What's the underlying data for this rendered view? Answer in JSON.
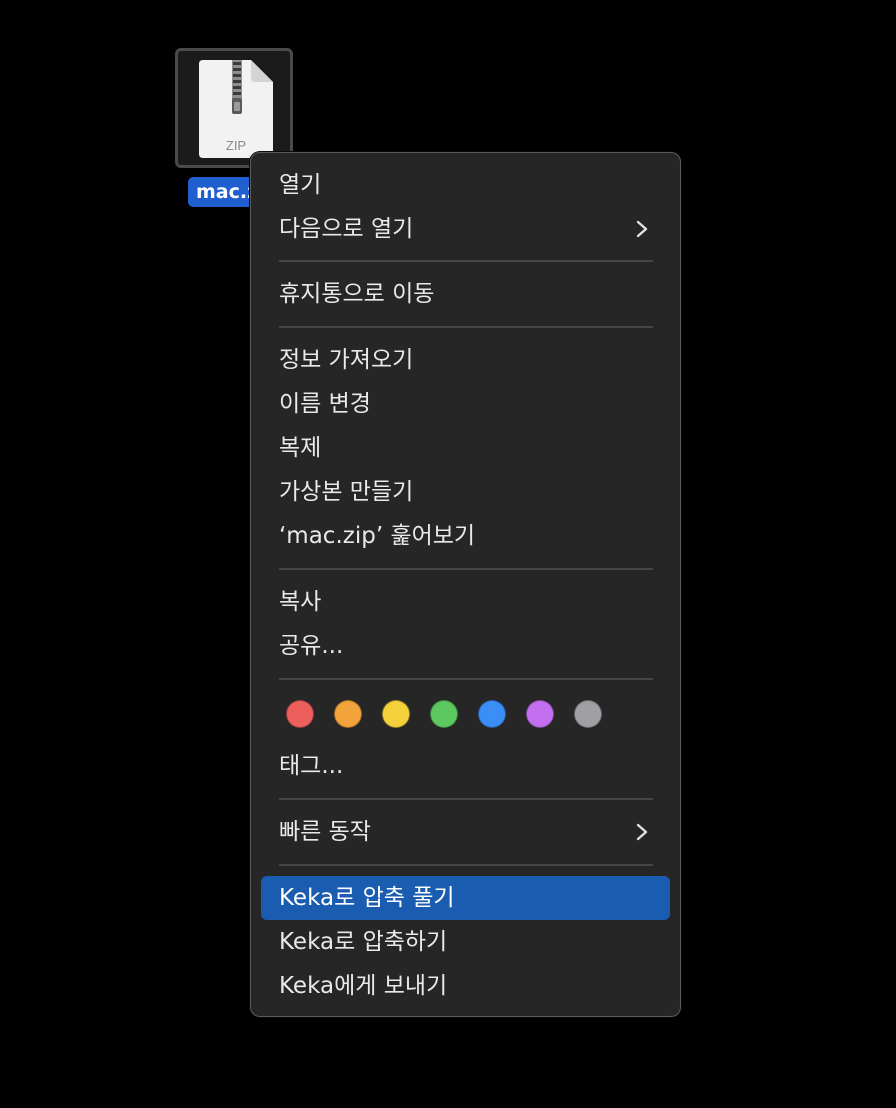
{
  "file": {
    "name": "mac.zip",
    "visible_label": "mac.z",
    "icon_label": "ZIP",
    "icon": "zip-archive-icon"
  },
  "menu": {
    "open": "열기",
    "open_with": "다음으로 열기",
    "move_to_trash": "휴지통으로 이동",
    "get_info": "정보 가져오기",
    "rename": "이름 변경",
    "duplicate": "복제",
    "make_alias": "가상본 만들기",
    "quick_look": "‘mac.zip’ 훑어보기",
    "copy": "복사",
    "share": "공유...",
    "tags": "태그...",
    "quick_actions": "빠른 동작",
    "keka_extract": "Keka로 압축 풀기",
    "keka_compress": "Keka로 압축하기",
    "keka_send": "Keka에게 보내기"
  },
  "tag_colors": [
    {
      "name": "red",
      "color": "#ec5f5d"
    },
    {
      "name": "orange",
      "color": "#f2a33b"
    },
    {
      "name": "yellow",
      "color": "#f5d23b"
    },
    {
      "name": "green",
      "color": "#5cc85f"
    },
    {
      "name": "blue",
      "color": "#3b8ef5"
    },
    {
      "name": "purple",
      "color": "#c46ef0"
    },
    {
      "name": "gray",
      "color": "#a0a0a4"
    }
  ],
  "colors": {
    "highlight": "#1a5cb0",
    "selection_label": "#1f5fd0",
    "menu_background": "#262626"
  }
}
